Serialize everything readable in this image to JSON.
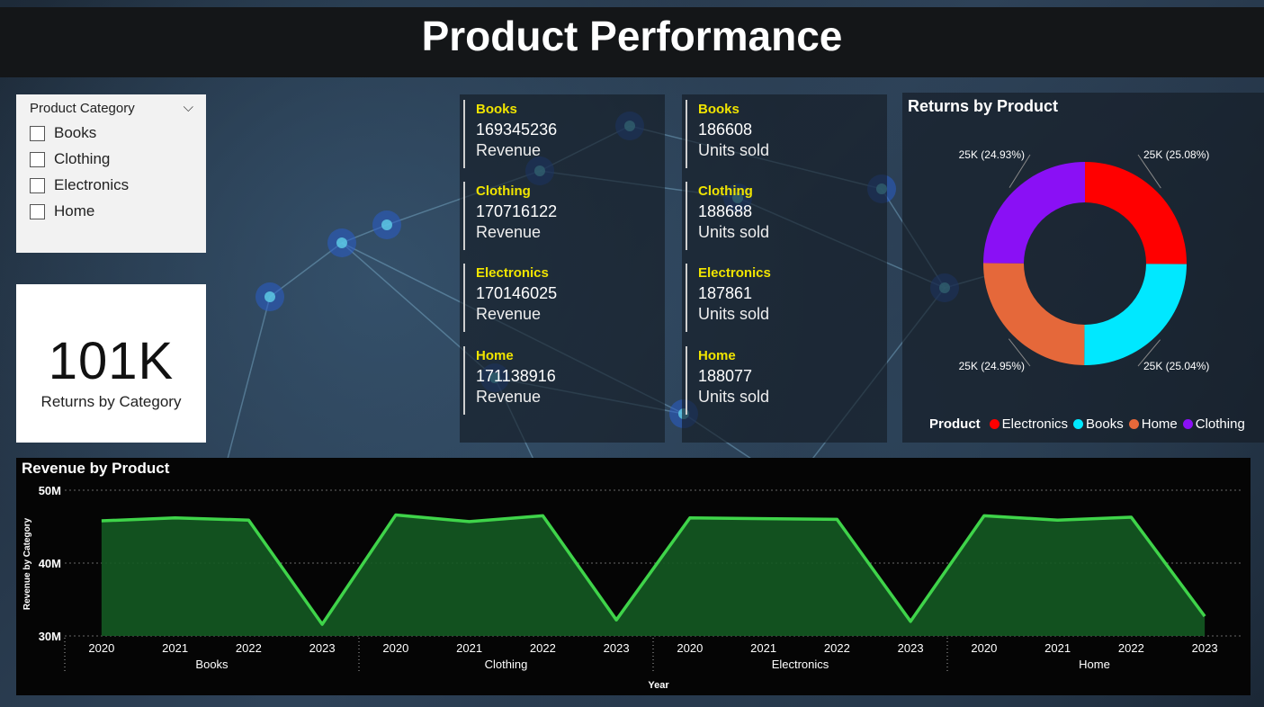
{
  "header": {
    "title": "Product Performance"
  },
  "slicer": {
    "title": "Product Category",
    "options": [
      "Books",
      "Clothing",
      "Electronics",
      "Home"
    ]
  },
  "kpi": {
    "value": "101K",
    "label": "Returns by Category"
  },
  "revenue_card": {
    "rows": [
      {
        "category": "Books",
        "value": "169345236",
        "label": "Revenue"
      },
      {
        "category": "Clothing",
        "value": "170716122",
        "label": "Revenue"
      },
      {
        "category": "Electronics",
        "value": "170146025",
        "label": "Revenue"
      },
      {
        "category": "Home",
        "value": "171138916",
        "label": "Revenue"
      }
    ]
  },
  "units_card": {
    "rows": [
      {
        "category": "Books",
        "value": "186608",
        "label": "Units sold"
      },
      {
        "category": "Clothing",
        "value": "188688",
        "label": "Units sold"
      },
      {
        "category": "Electronics",
        "value": "187861",
        "label": "Units sold"
      },
      {
        "category": "Home",
        "value": "188077",
        "label": "Units sold"
      }
    ]
  },
  "colors": {
    "Electronics": "#ff0000",
    "Books": "#00e8ff",
    "Home": "#e5683a",
    "Clothing": "#8a10f5",
    "line": "#3fd44a",
    "area": "#145a22",
    "category_yellow": "#f0e400"
  },
  "chart_data": [
    {
      "type": "pie",
      "variant": "donut",
      "title": "Returns by Product",
      "legend_title": "Product",
      "legend_position": "bottom",
      "slices": [
        {
          "name": "Electronics",
          "value": 25.08,
          "label": "25K (25.08%)"
        },
        {
          "name": "Books",
          "value": 25.04,
          "label": "25K (25.04%)"
        },
        {
          "name": "Home",
          "value": 24.95,
          "label": "25K (24.95%)"
        },
        {
          "name": "Clothing",
          "value": 24.93,
          "label": "25K (24.93%)"
        }
      ]
    },
    {
      "type": "area",
      "title": "Revenue by Product",
      "xlabel": "Year",
      "ylabel": "Revenue by Category",
      "ylim": [
        30,
        50
      ],
      "yticks": [
        "30M",
        "40M",
        "50M"
      ],
      "yticks_values": [
        30,
        40,
        50
      ],
      "groups": [
        "Books",
        "Clothing",
        "Electronics",
        "Home"
      ],
      "years": [
        "2020",
        "2021",
        "2022",
        "2023"
      ],
      "values": [
        [
          45.8,
          46.2,
          45.9,
          31.6
        ],
        [
          46.6,
          45.7,
          46.5,
          32.2
        ],
        [
          46.2,
          46.1,
          46.0,
          32.0
        ],
        [
          46.5,
          45.9,
          46.3,
          32.7
        ]
      ],
      "grid": true
    }
  ]
}
